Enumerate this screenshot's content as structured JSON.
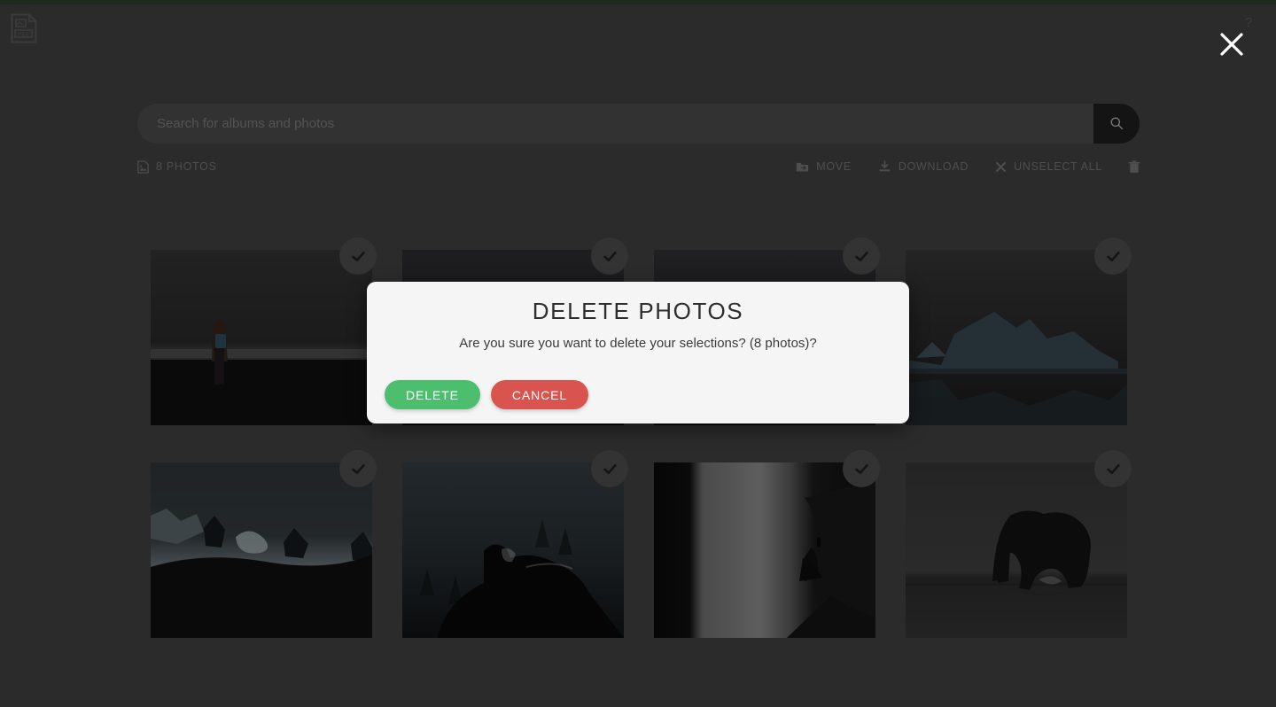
{
  "theme": {
    "background": "#2b2b2b",
    "top_strip": "#1d2c1d",
    "accent_delete": "#4CBE6E",
    "accent_cancel": "#D9534F",
    "modal_background": "#f5f5f5",
    "toolbar_text": "#4e4e4e"
  },
  "header": {
    "broken_image_icon": "broken-image-icon",
    "close_icon": "close-icon",
    "help_glyph": "?"
  },
  "search": {
    "value": "",
    "placeholder": "Search for albums and photos",
    "button_icon": "search-icon"
  },
  "toolbar": {
    "count_icon": "photo-icon",
    "count_label": "8 PHOTOS",
    "actions": [
      {
        "id": "move",
        "label": "MOVE",
        "icon": "folder-move-icon"
      },
      {
        "id": "download",
        "label": "DOWNLOAD",
        "icon": "download-icon"
      },
      {
        "id": "unselect-all",
        "label": "UNSELECT ALL",
        "icon": "close-x-icon"
      }
    ],
    "delete_icon": "trash-icon"
  },
  "grid": {
    "selected_icon": "check-icon",
    "photos": [
      {
        "id": "photo-1",
        "alt": "Person with backpack on dark beach",
        "selected": true
      },
      {
        "id": "photo-2",
        "alt": "Dark landscape",
        "selected": true
      },
      {
        "id": "photo-3",
        "alt": "Dark landscape",
        "selected": true
      },
      {
        "id": "photo-4",
        "alt": "Icebergs reflected in glacier lagoon",
        "selected": true
      },
      {
        "id": "photo-5",
        "alt": "Rocky snowy coastline with waves",
        "selected": true
      },
      {
        "id": "photo-6",
        "alt": "Horse in front of forest",
        "selected": true
      },
      {
        "id": "photo-7",
        "alt": "Waterfall with person on cliff",
        "selected": true
      },
      {
        "id": "photo-8",
        "alt": "Hvitserkur rock formation in sea",
        "selected": true
      }
    ]
  },
  "modal": {
    "title": "DELETE PHOTOS",
    "message": "Are you sure you want to delete your selections? (8 photos)?",
    "confirm_label": "DELETE",
    "cancel_label": "CANCEL"
  }
}
